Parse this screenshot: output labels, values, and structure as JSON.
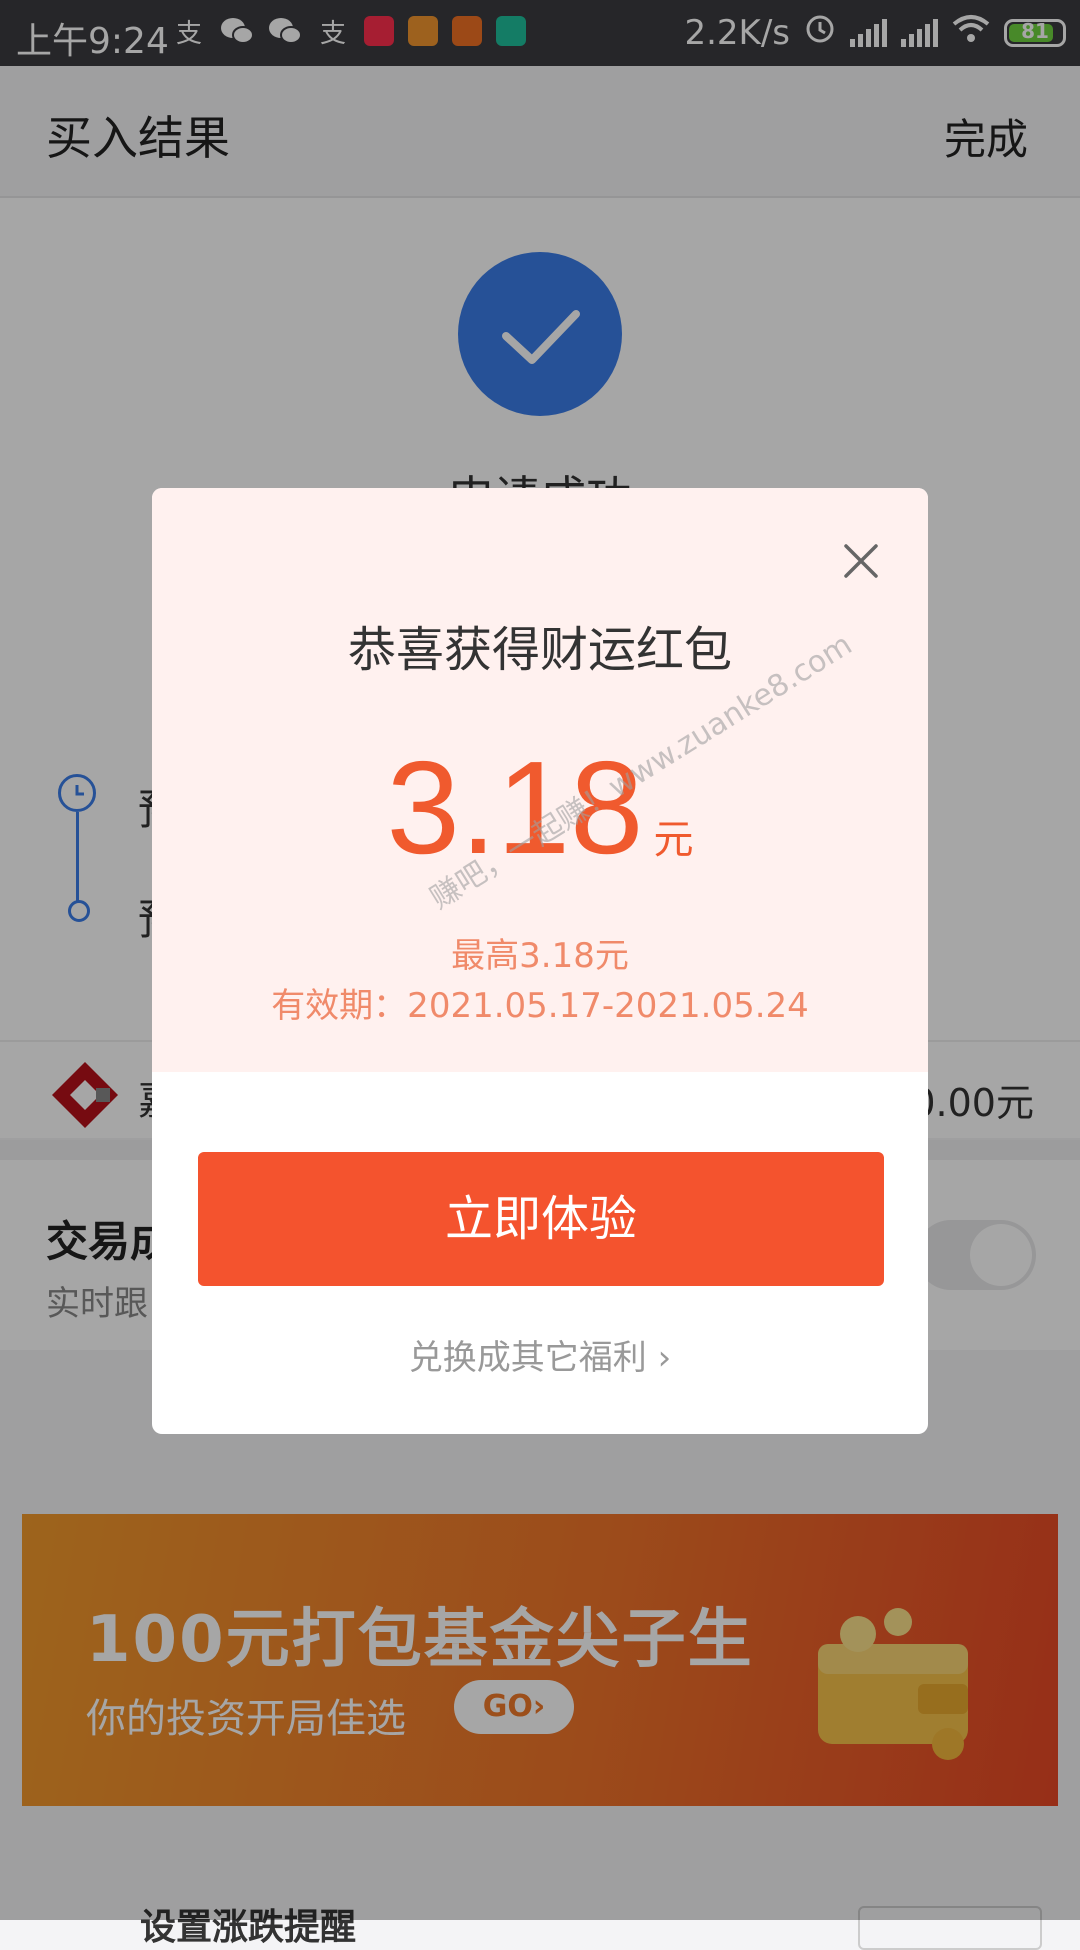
{
  "status_bar": {
    "time": "上午9:24",
    "network_speed": "2.2K/s",
    "battery": "81",
    "notification_icons": [
      "alipay-icon",
      "wechat-icon",
      "wechat-icon",
      "alipay-icon",
      "xiaohongshu-icon",
      "app-icon",
      "pingan-icon",
      "app-icon"
    ]
  },
  "header": {
    "title": "买入结果",
    "done_label": "完成"
  },
  "background": {
    "success_text": "申请成功",
    "timeline_1": "预",
    "timeline_2": "预",
    "fund_name": "嘉",
    "fund_amount": "0.00元",
    "trade_title": "交易成",
    "trade_sub": "实时跟",
    "banner_title": "100元打包基金尖子生",
    "banner_sub": "你的投资开局佳选",
    "banner_go": "GO›",
    "remind_text": "设置涨跌提醒"
  },
  "modal": {
    "title": "恭喜获得财运红包",
    "amount": "3.18",
    "unit": "元",
    "max_line": "最高3.18元",
    "valid_line": "有效期：2021.05.17-2021.05.24",
    "cta_label": "立即体验",
    "exchange_label": "兑换成其它福利 ›"
  },
  "watermark": "赚吧，一起赚！www.zuanke8.com",
  "colors": {
    "accent": "#f4532e",
    "amount": "#f05a2e",
    "success_blue": "#3b7de8",
    "battery_green": "#6fd33f"
  }
}
